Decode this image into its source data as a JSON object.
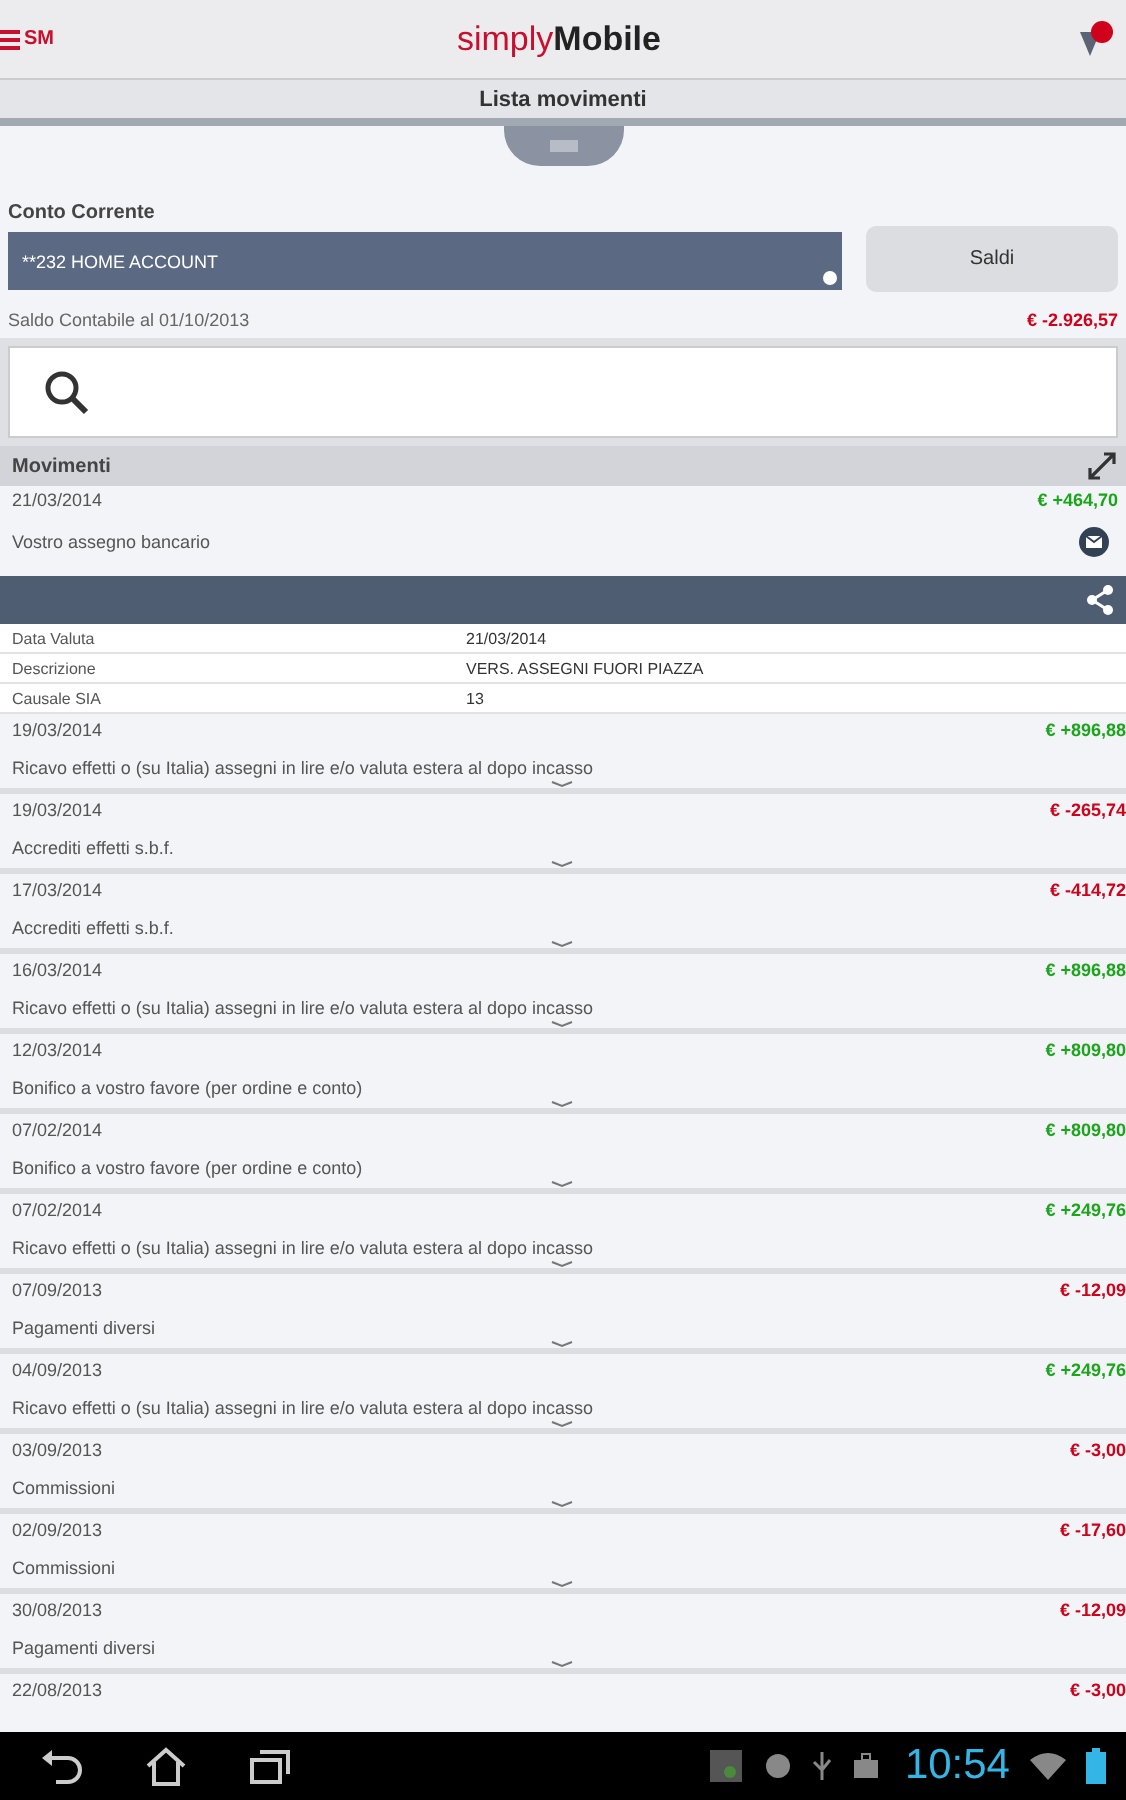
{
  "header": {
    "brand_part_1": "simply",
    "brand_part_2": "Mobile",
    "logo_letters": "SM"
  },
  "title_bar": {
    "title": "Lista movimenti"
  },
  "account": {
    "label": "Conto Corrente",
    "value": "**232 HOME ACCOUNT",
    "button": "Saldi",
    "balance_label": "Saldo Contabile al 01/10/2013",
    "balance": "€ -2.926,57"
  },
  "movements": {
    "title": "Movimenti",
    "rows": [
      {
        "date": "21/03/2014",
        "description": "Vostro assegno bancario",
        "amount": "€ +464,70",
        "kind": "credit",
        "expanded": true,
        "details": [
          {
            "label": "Data Valuta",
            "value": "21/03/2014"
          },
          {
            "label": "Descrizione",
            "value": "VERS. ASSEGNI FUORI PIAZZA"
          },
          {
            "label": "Causale SIA",
            "value": "13"
          }
        ]
      },
      {
        "date": "19/03/2014",
        "description": "Ricavo effetti o (su Italia) assegni in lire e/o valuta estera al dopo incasso",
        "amount": "€ +896,88",
        "kind": "credit",
        "expanded": false
      },
      {
        "date": "19/03/2014",
        "description": "Accrediti effetti s.b.f.",
        "amount": "€ -265,74",
        "kind": "debit",
        "expanded": false
      },
      {
        "date": "17/03/2014",
        "description": "Accrediti effetti s.b.f.",
        "amount": "€ -414,72",
        "kind": "debit",
        "expanded": false
      },
      {
        "date": "16/03/2014",
        "description": "Ricavo effetti o (su Italia) assegni in lire e/o valuta estera al dopo incasso",
        "amount": "€ +896,88",
        "kind": "credit",
        "expanded": false
      },
      {
        "date": "12/03/2014",
        "description": "Bonifico a vostro favore (per ordine e conto)",
        "amount": "€ +809,80",
        "kind": "credit",
        "expanded": false
      },
      {
        "date": "07/02/2014",
        "description": "Bonifico a vostro favore (per ordine e conto)",
        "amount": "€ +809,80",
        "kind": "credit",
        "expanded": false
      },
      {
        "date": "07/02/2014",
        "description": "Ricavo effetti o (su Italia) assegni in lire e/o valuta estera al dopo incasso",
        "amount": "€ +249,76",
        "kind": "credit",
        "expanded": false
      },
      {
        "date": "07/09/2013",
        "description": "Pagamenti diversi",
        "amount": "€ -12,09",
        "kind": "debit",
        "expanded": false
      },
      {
        "date": "04/09/2013",
        "description": "Ricavo effetti o (su Italia) assegni in lire e/o valuta estera al dopo incasso",
        "amount": "€ +249,76",
        "kind": "credit",
        "expanded": false
      },
      {
        "date": "03/09/2013",
        "description": "Commissioni",
        "amount": "€ -3,00",
        "kind": "debit",
        "expanded": false
      },
      {
        "date": "02/09/2013",
        "description": "Commissioni",
        "amount": "€ -17,60",
        "kind": "debit",
        "expanded": false
      },
      {
        "date": "30/08/2013",
        "description": "Pagamenti diversi",
        "amount": "€ -12,09",
        "kind": "debit",
        "expanded": false
      },
      {
        "date": "22/08/2013",
        "amount": "€ -3,00",
        "kind": "debit",
        "expanded": false
      }
    ]
  },
  "system_bar": {
    "time": "10:54"
  }
}
